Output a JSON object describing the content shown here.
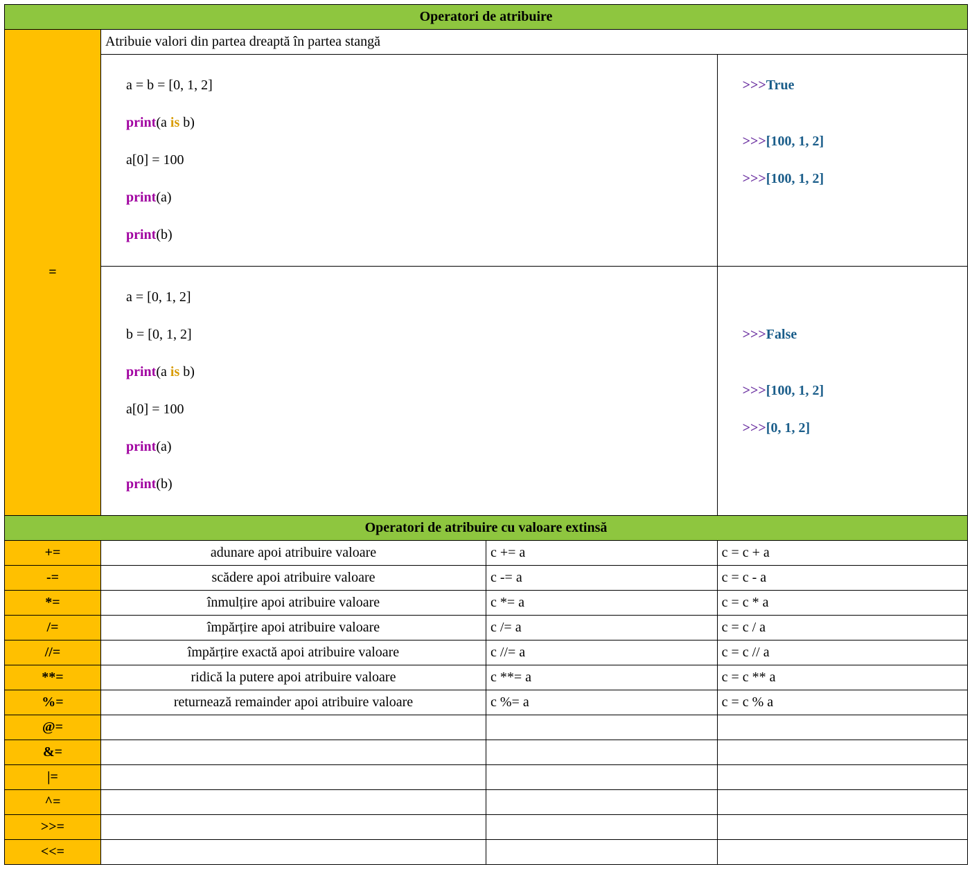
{
  "header1": "Operatori de atribuire",
  "eq": {
    "symbol": "=",
    "desc": "Atribuie valori din partea dreaptă în partea stangă",
    "ex1": {
      "l1": "a = b = [0, 1, 2]",
      "l2a": "print",
      "l2b": "(a ",
      "l2c": "is",
      "l2d": " b)",
      "l3": "a[0] = 100",
      "l4a": "print",
      "l4b": "(a)",
      "l5a": "print",
      "l5b": "(b)",
      "o1p": ">>>",
      "o1v": "True",
      "o2p": ">>>",
      "o2v": "[100, 1, 2]",
      "o3p": ">>>",
      "o3v": "[100, 1, 2]"
    },
    "ex2": {
      "l1": "a = [0, 1, 2]",
      "l2": "b = [0, 1, 2]",
      "l3a": "print",
      "l3b": "(a ",
      "l3c": "is",
      "l3d": " b)",
      "l4": "a[0] = 100",
      "l5a": "print",
      "l5b": "(a)",
      "l6a": "print",
      "l6b": "(b)",
      "o1p": ">>>",
      "o1v": "False",
      "o2p": ">>>",
      "o2v": "[100, 1, 2]",
      "o3p": ">>>",
      "o3v": "[0, 1, 2]"
    }
  },
  "header2": "Operatori de atribuire cu valoare extinsă",
  "rows": [
    {
      "op": "+=",
      "desc": "adunare apoi atribuire valoare",
      "use": "c += a",
      "equiv": "c = c + a"
    },
    {
      "op": "-=",
      "desc": "scădere apoi atribuire valoare",
      "use": "c -= a",
      "equiv": "c = c - a"
    },
    {
      "op": "*=",
      "desc": "înmulțire apoi atribuire valoare",
      "use": "c *= a",
      "equiv": "c = c * a"
    },
    {
      "op": "/=",
      "desc": "împărțire apoi atribuire valoare",
      "use": "c /= a",
      "equiv": "c = c / a"
    },
    {
      "op": "//=",
      "desc": "împărțire exactă apoi atribuire valoare",
      "use": "c //= a",
      "equiv": "c = c // a"
    },
    {
      "op": "**=",
      "desc": "ridică la putere apoi atribuire valoare",
      "use": "c **= a",
      "equiv": "c = c ** a"
    },
    {
      "op": "%=",
      "desc": "returnează remainder apoi atribuire valoare",
      "use": "c %= a",
      "equiv": "c = c % a"
    },
    {
      "op": "@=",
      "desc": "",
      "use": "",
      "equiv": ""
    },
    {
      "op": "&=",
      "desc": "",
      "use": "",
      "equiv": ""
    },
    {
      "op": "|=",
      "desc": "",
      "use": "",
      "equiv": ""
    },
    {
      "op": "^=",
      "desc": "",
      "use": "",
      "equiv": ""
    },
    {
      "op": ">>=",
      "desc": "",
      "use": "",
      "equiv": ""
    },
    {
      "op": "<<=",
      "desc": "",
      "use": "",
      "equiv": ""
    }
  ]
}
